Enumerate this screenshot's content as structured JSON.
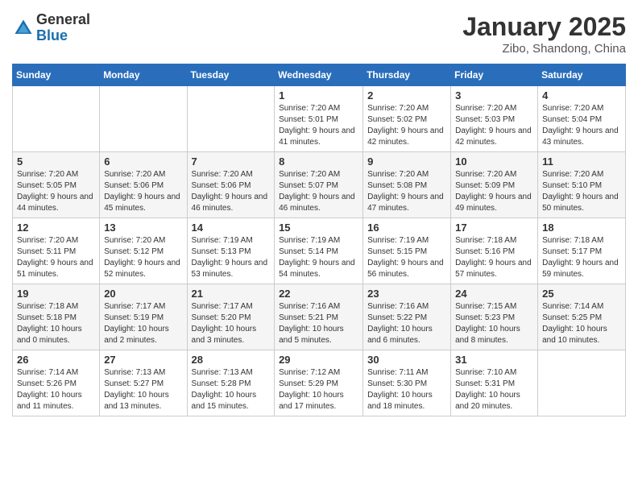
{
  "logo": {
    "general": "General",
    "blue": "Blue"
  },
  "title": "January 2025",
  "location": "Zibo, Shandong, China",
  "days_of_week": [
    "Sunday",
    "Monday",
    "Tuesday",
    "Wednesday",
    "Thursday",
    "Friday",
    "Saturday"
  ],
  "weeks": [
    [
      {
        "day": "",
        "info": ""
      },
      {
        "day": "",
        "info": ""
      },
      {
        "day": "",
        "info": ""
      },
      {
        "day": "1",
        "info": "Sunrise: 7:20 AM\nSunset: 5:01 PM\nDaylight: 9 hours and 41 minutes."
      },
      {
        "day": "2",
        "info": "Sunrise: 7:20 AM\nSunset: 5:02 PM\nDaylight: 9 hours and 42 minutes."
      },
      {
        "day": "3",
        "info": "Sunrise: 7:20 AM\nSunset: 5:03 PM\nDaylight: 9 hours and 42 minutes."
      },
      {
        "day": "4",
        "info": "Sunrise: 7:20 AM\nSunset: 5:04 PM\nDaylight: 9 hours and 43 minutes."
      }
    ],
    [
      {
        "day": "5",
        "info": "Sunrise: 7:20 AM\nSunset: 5:05 PM\nDaylight: 9 hours and 44 minutes."
      },
      {
        "day": "6",
        "info": "Sunrise: 7:20 AM\nSunset: 5:06 PM\nDaylight: 9 hours and 45 minutes."
      },
      {
        "day": "7",
        "info": "Sunrise: 7:20 AM\nSunset: 5:06 PM\nDaylight: 9 hours and 46 minutes."
      },
      {
        "day": "8",
        "info": "Sunrise: 7:20 AM\nSunset: 5:07 PM\nDaylight: 9 hours and 46 minutes."
      },
      {
        "day": "9",
        "info": "Sunrise: 7:20 AM\nSunset: 5:08 PM\nDaylight: 9 hours and 47 minutes."
      },
      {
        "day": "10",
        "info": "Sunrise: 7:20 AM\nSunset: 5:09 PM\nDaylight: 9 hours and 49 minutes."
      },
      {
        "day": "11",
        "info": "Sunrise: 7:20 AM\nSunset: 5:10 PM\nDaylight: 9 hours and 50 minutes."
      }
    ],
    [
      {
        "day": "12",
        "info": "Sunrise: 7:20 AM\nSunset: 5:11 PM\nDaylight: 9 hours and 51 minutes."
      },
      {
        "day": "13",
        "info": "Sunrise: 7:20 AM\nSunset: 5:12 PM\nDaylight: 9 hours and 52 minutes."
      },
      {
        "day": "14",
        "info": "Sunrise: 7:19 AM\nSunset: 5:13 PM\nDaylight: 9 hours and 53 minutes."
      },
      {
        "day": "15",
        "info": "Sunrise: 7:19 AM\nSunset: 5:14 PM\nDaylight: 9 hours and 54 minutes."
      },
      {
        "day": "16",
        "info": "Sunrise: 7:19 AM\nSunset: 5:15 PM\nDaylight: 9 hours and 56 minutes."
      },
      {
        "day": "17",
        "info": "Sunrise: 7:18 AM\nSunset: 5:16 PM\nDaylight: 9 hours and 57 minutes."
      },
      {
        "day": "18",
        "info": "Sunrise: 7:18 AM\nSunset: 5:17 PM\nDaylight: 9 hours and 59 minutes."
      }
    ],
    [
      {
        "day": "19",
        "info": "Sunrise: 7:18 AM\nSunset: 5:18 PM\nDaylight: 10 hours and 0 minutes."
      },
      {
        "day": "20",
        "info": "Sunrise: 7:17 AM\nSunset: 5:19 PM\nDaylight: 10 hours and 2 minutes."
      },
      {
        "day": "21",
        "info": "Sunrise: 7:17 AM\nSunset: 5:20 PM\nDaylight: 10 hours and 3 minutes."
      },
      {
        "day": "22",
        "info": "Sunrise: 7:16 AM\nSunset: 5:21 PM\nDaylight: 10 hours and 5 minutes."
      },
      {
        "day": "23",
        "info": "Sunrise: 7:16 AM\nSunset: 5:22 PM\nDaylight: 10 hours and 6 minutes."
      },
      {
        "day": "24",
        "info": "Sunrise: 7:15 AM\nSunset: 5:23 PM\nDaylight: 10 hours and 8 minutes."
      },
      {
        "day": "25",
        "info": "Sunrise: 7:14 AM\nSunset: 5:25 PM\nDaylight: 10 hours and 10 minutes."
      }
    ],
    [
      {
        "day": "26",
        "info": "Sunrise: 7:14 AM\nSunset: 5:26 PM\nDaylight: 10 hours and 11 minutes."
      },
      {
        "day": "27",
        "info": "Sunrise: 7:13 AM\nSunset: 5:27 PM\nDaylight: 10 hours and 13 minutes."
      },
      {
        "day": "28",
        "info": "Sunrise: 7:13 AM\nSunset: 5:28 PM\nDaylight: 10 hours and 15 minutes."
      },
      {
        "day": "29",
        "info": "Sunrise: 7:12 AM\nSunset: 5:29 PM\nDaylight: 10 hours and 17 minutes."
      },
      {
        "day": "30",
        "info": "Sunrise: 7:11 AM\nSunset: 5:30 PM\nDaylight: 10 hours and 18 minutes."
      },
      {
        "day": "31",
        "info": "Sunrise: 7:10 AM\nSunset: 5:31 PM\nDaylight: 10 hours and 20 minutes."
      },
      {
        "day": "",
        "info": ""
      }
    ]
  ]
}
